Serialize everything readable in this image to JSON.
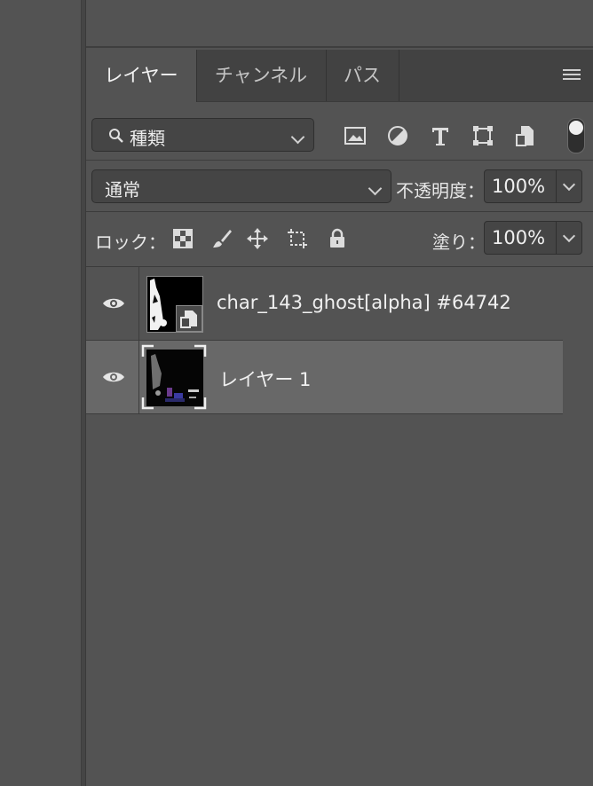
{
  "tabs": [
    {
      "label": "レイヤー",
      "active": true
    },
    {
      "label": "チャンネル",
      "active": false
    },
    {
      "label": "パス",
      "active": false
    }
  ],
  "filter": {
    "kind_label": "種類"
  },
  "blend": {
    "mode": "通常",
    "opacity_label": "不透明度：",
    "opacity_value": "100%"
  },
  "lock": {
    "label": "ロック：",
    "fill_label": "塗り：",
    "fill_value": "100%"
  },
  "layers": [
    {
      "name": "char_143_ghost[alpha] #64742",
      "visible": true,
      "selected": false,
      "type": "smart-object"
    },
    {
      "name": "レイヤー 1",
      "visible": true,
      "selected": true,
      "type": "pixel"
    }
  ],
  "colors": {
    "panel_bg": "#535353",
    "tab_bar_bg": "#424242",
    "selected_layer_bg": "#686868"
  }
}
